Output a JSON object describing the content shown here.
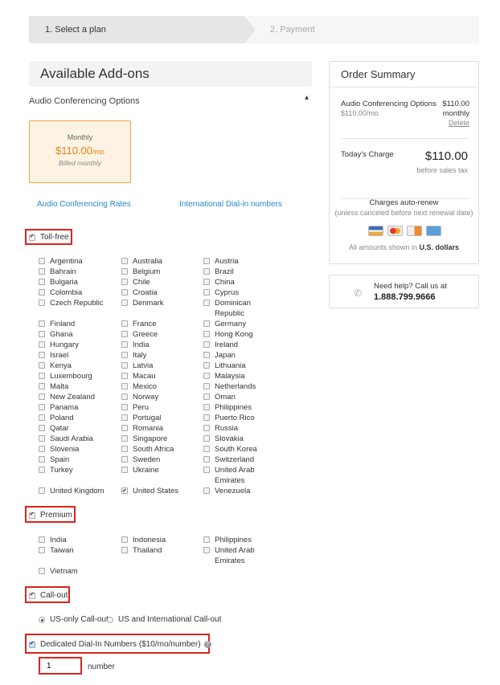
{
  "steps": {
    "step1": "1. Select a plan",
    "step2": "2. Payment"
  },
  "addons": {
    "header": "Available Add-ons",
    "section": "Audio Conferencing Options",
    "plan": {
      "label": "Monthly",
      "price": "$110.00",
      "per": "/mo",
      "billed": "Billed monthly"
    },
    "links": {
      "rates": "Audio Conferencing Rates",
      "international": "International Dial-in numbers"
    },
    "tollfree": {
      "label": "Toll-free",
      "col1": [
        "Argentina",
        "Bahrain",
        "Bulgaria",
        "Colombia",
        "Czech Republic",
        "Finland",
        "Ghana",
        "Hungary",
        "Israel",
        "Kenya",
        "Luxembourg",
        "Malta",
        "New Zealand",
        "Panama",
        "Poland",
        "Qatar",
        "Saudi Arabia",
        "Slovenia",
        "Spain",
        "Turkey",
        "United Kingdom"
      ],
      "col2": [
        "Australia",
        "Belgium",
        "Chile",
        "Croatia",
        "Denmark",
        "France",
        "Greece",
        "India",
        "Italy",
        "Latvia",
        "Macau",
        "Mexico",
        "Norway",
        "Peru",
        "Portugal",
        "Romania",
        "Singapore",
        "South Africa",
        "Sweden",
        "Ukraine",
        "United States"
      ],
      "col3": [
        "Austria",
        "Brazil",
        "China",
        "Cyprus",
        "Dominican Republic",
        "Germany",
        "Hong Kong",
        "Ireland",
        "Japan",
        "Lithuania",
        "Malaysia",
        "Netherlands",
        "Oman",
        "Philippines",
        "Puerto Rico",
        "Russia",
        "Slovakia",
        "South Korea",
        "Switzerland",
        "United Arab Emirates",
        "Venezuela"
      ]
    },
    "premium": {
      "label": "Premium",
      "col1": [
        "India",
        "Taiwan",
        "Vietnam"
      ],
      "col2": [
        "Indonesia",
        "Thailand"
      ],
      "col3": [
        "Philippines",
        "United Arab Emirates"
      ]
    },
    "callout": {
      "label": "Call-out",
      "opt1": "US-only Call-out",
      "opt2": "US and International Call-out"
    },
    "dedicated": {
      "label": "Dedicated Dial-In Numbers ($10/mo/number)",
      "qty": "1",
      "unit": "number"
    }
  },
  "order": {
    "title": "Order Summary",
    "line_name": "Audio Conferencing Options",
    "line_sub": "$110.00/mo",
    "line_amt": "$110.00",
    "line_freq": "monthly",
    "delete": "Delete",
    "today_label": "Today's Charge",
    "today_amt": "$110.00",
    "today_sub": "before sales tax",
    "renew": "Charges auto-renew",
    "renew_sub": "(unless canceled before next renewal date)",
    "currency_prefix": "All amounts shown in",
    "currency": "U.S. dollars"
  },
  "help": {
    "line1": "Need help? Call us at",
    "phone": "1.888.799.9666"
  }
}
